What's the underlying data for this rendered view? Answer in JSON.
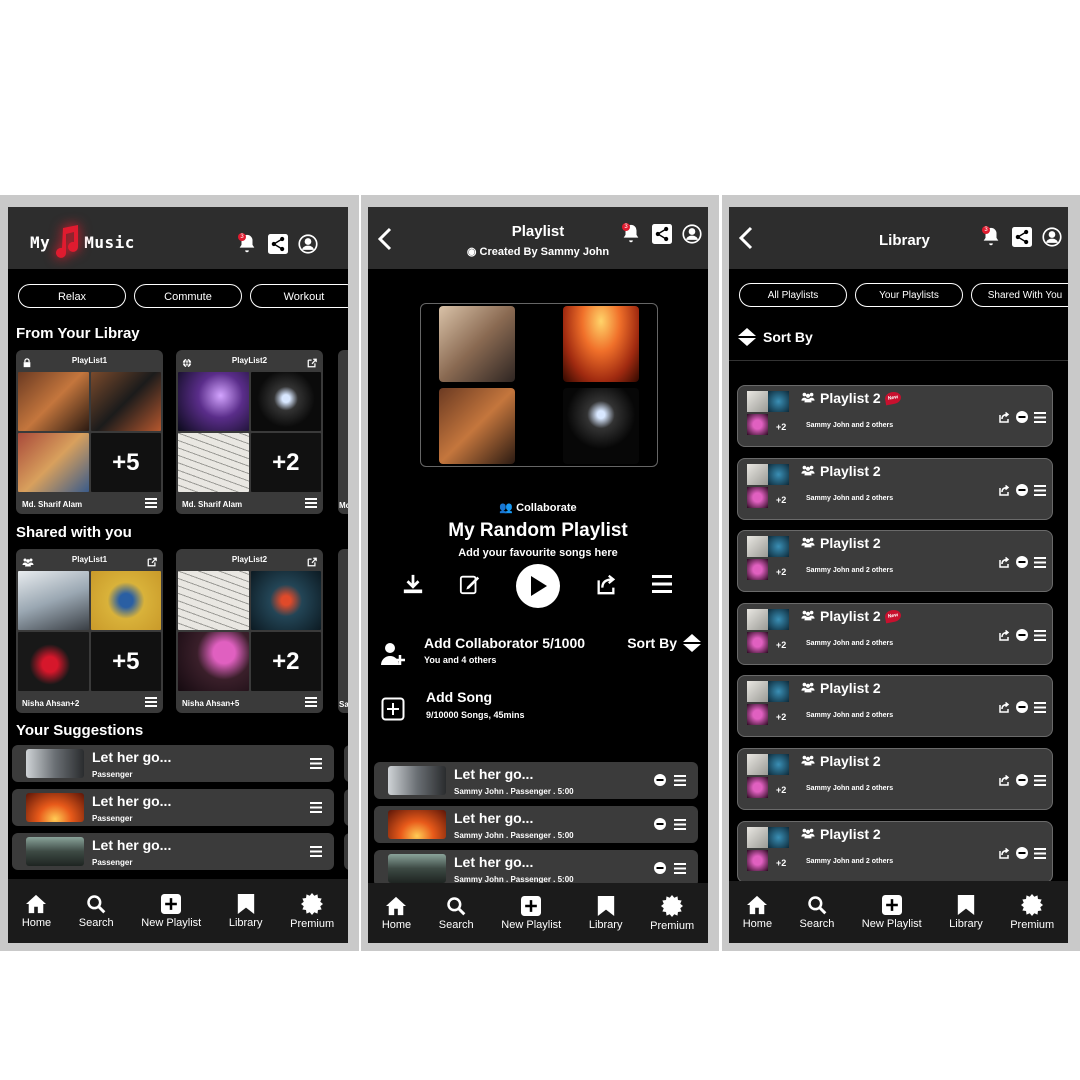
{
  "colors": {
    "accent": "#e01b2f",
    "header": "#2d2d2d",
    "card": "#3a3a3a",
    "background": "#000000"
  },
  "screen1": {
    "logo_left": "My",
    "logo_right": "Music",
    "notif_count": "3",
    "chips": [
      "Relax",
      "Commute",
      "Workout"
    ],
    "library_title": "From Your Libray",
    "library_cards": [
      {
        "name": "PlayList1",
        "count": "+5",
        "owner": "Md. Sharif Alam",
        "icon": "lock-icon"
      },
      {
        "name": "PlayList2",
        "count": "+2",
        "owner": "Md. Sharif Alam",
        "icon": "globe-icon"
      }
    ],
    "peek_library": "Mc",
    "shared_title": "Shared with you",
    "shared_cards": [
      {
        "name": "PlayList1",
        "count": "+5",
        "owner": "Nisha Ahsan+2",
        "icon": "group-icon"
      },
      {
        "name": "PlayList2",
        "count": "+2",
        "owner": "Nisha Ahsan+5",
        "icon": "group-icon"
      }
    ],
    "peek_shared": "Sa",
    "suggest_title": "Your Suggestions",
    "suggestions": [
      {
        "title": "Let her go...",
        "artist": "Passenger"
      },
      {
        "title": "Let her go...",
        "artist": "Passenger"
      },
      {
        "title": "Let her go...",
        "artist": "Passenger"
      }
    ]
  },
  "screen2": {
    "title": "Playlist",
    "creator": "Created By Sammy John",
    "notif_count": "3",
    "collab_label": "Collaborate",
    "playlist_name": "My Random Playlist",
    "playlist_desc": "Add your favourite songs here",
    "add_collab": "Add Collaborator 5/1000",
    "add_collab_sub": "You and 4 others",
    "sort_by": "Sort By",
    "add_song": "Add Song",
    "add_song_sub": "9/10000 Songs, 45mins",
    "songs": [
      {
        "title": "Let her go...",
        "meta": "Sammy John . Passenger . 5:00"
      },
      {
        "title": "Let her go...",
        "meta": "Sammy John . Passenger . 5:00"
      },
      {
        "title": "Let her go...",
        "meta": "Sammy John . Passenger . 5:00"
      }
    ]
  },
  "screen3": {
    "title": "Library",
    "notif_count": "3",
    "chips": [
      "All Playlists",
      "Your Playlists",
      "Shared With You"
    ],
    "sort_by": "Sort By",
    "new_label": "New",
    "rows": [
      {
        "title": "Playlist 2",
        "plus": "+2",
        "sub": "Sammy John and 2 others",
        "is_new": true
      },
      {
        "title": "Playlist 2",
        "plus": "+2",
        "sub": "Sammy John and 2 others",
        "is_new": false
      },
      {
        "title": "Playlist 2",
        "plus": "+2",
        "sub": "Sammy John and 2 others",
        "is_new": false
      },
      {
        "title": "Playlist 2",
        "plus": "+2",
        "sub": "Sammy John and 2 others",
        "is_new": true
      },
      {
        "title": "Playlist 2",
        "plus": "+2",
        "sub": "Sammy John and 2 others",
        "is_new": false
      },
      {
        "title": "Playlist 2",
        "plus": "+2",
        "sub": "Sammy John and 2 others",
        "is_new": false
      },
      {
        "title": "Playlist 2",
        "plus": "+2",
        "sub": "Sammy John and 2 others",
        "is_new": false
      }
    ]
  },
  "nav": [
    "Home",
    "Search",
    "New Playlist",
    "Library",
    "Premium"
  ]
}
